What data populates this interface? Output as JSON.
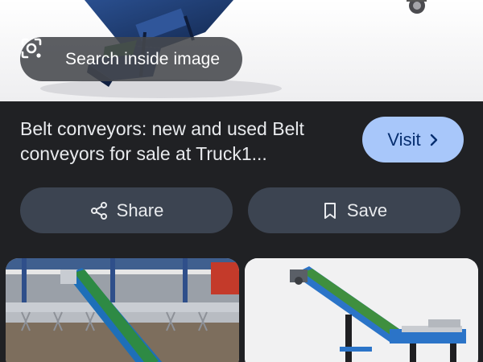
{
  "lens": {
    "label": "Search inside image",
    "icon": "lens-camera-icon"
  },
  "result": {
    "title": "Belt conveyors: new and used Belt conveyors for sale at Truck1...",
    "visit_label": "Visit"
  },
  "actions": {
    "share_label": "Share",
    "save_label": "Save"
  },
  "colors": {
    "background": "#202124",
    "visit_button": "#a8c7fa",
    "action_button": "#3c4451",
    "text": "#e8eaed"
  }
}
